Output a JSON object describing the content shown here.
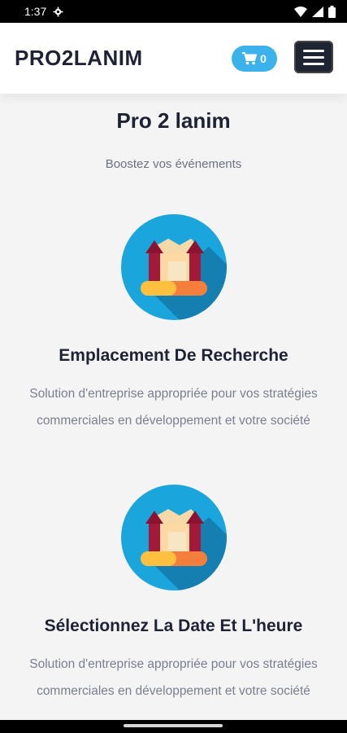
{
  "status": {
    "time": "1:37"
  },
  "header": {
    "brand": "PRO2LANIM",
    "cart_count": "0"
  },
  "hero": {
    "title": "Pro 2 lanim",
    "tagline": "Boostez vos événements"
  },
  "features": [
    {
      "title": "Emplacement De Recherche",
      "text": "Solution d'entreprise appropriée pour vos stratégies commerciales en développement et votre société",
      "icon": "bouncy-castle-icon"
    },
    {
      "title": "Sélectionnez La Date Et L'heure",
      "text": "Solution d'entreprise appropriée pour vos stratégies commerciales en développement et votre société",
      "icon": "bouncy-castle-icon"
    }
  ],
  "colors": {
    "accent": "#3bb2ec",
    "menu": "#1f2433",
    "text": "#1e2235"
  }
}
